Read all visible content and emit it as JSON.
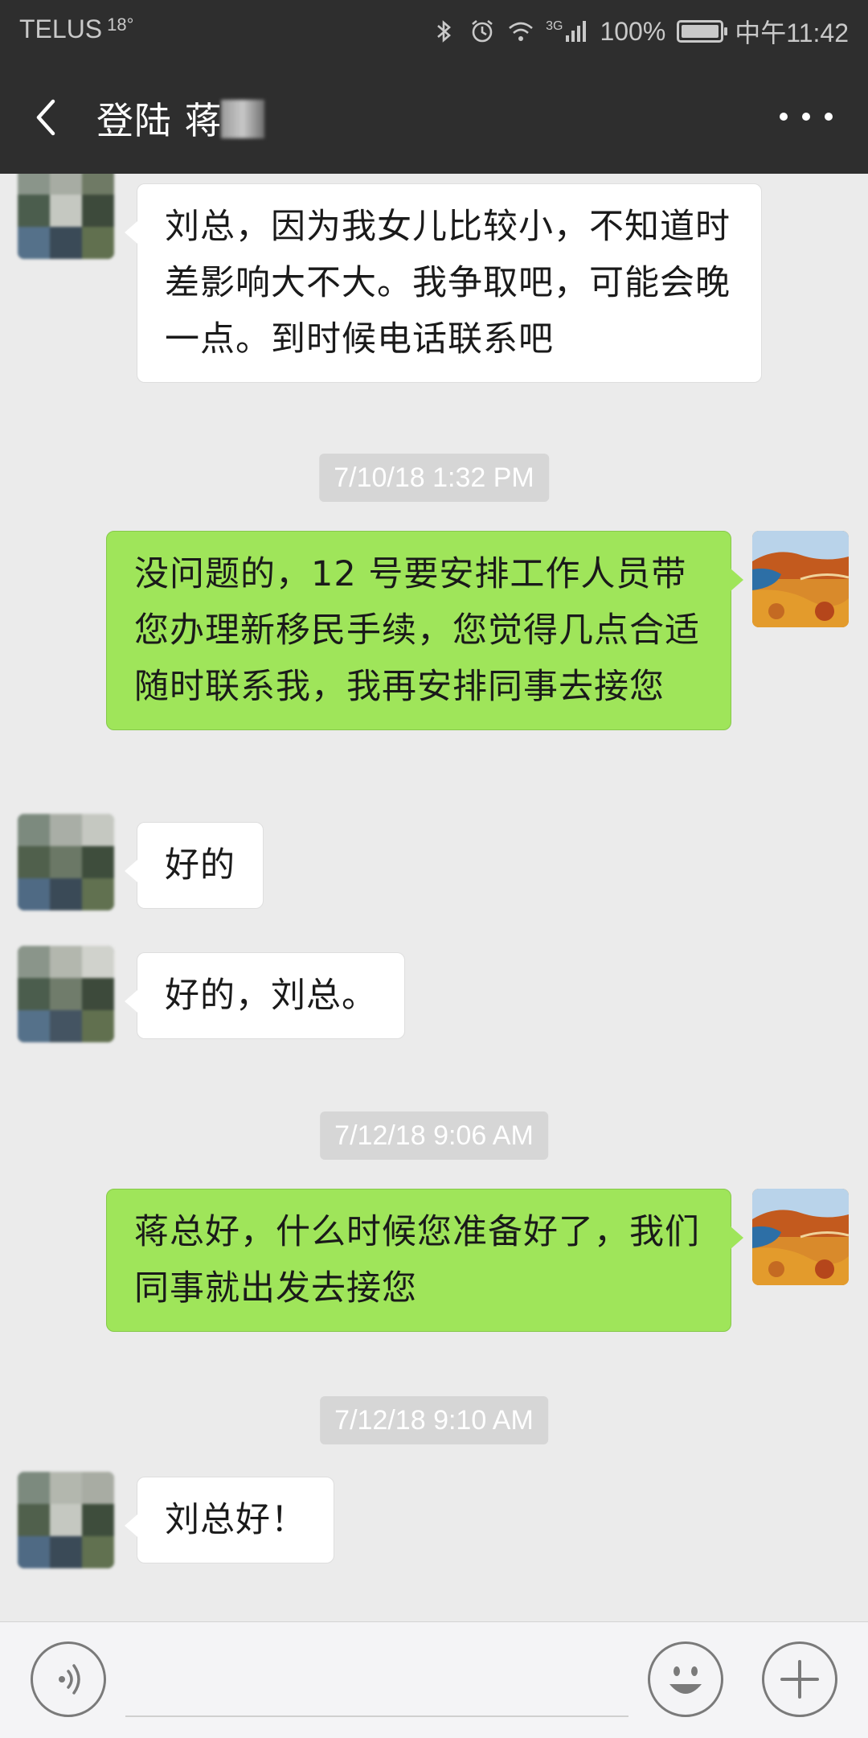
{
  "status_bar": {
    "carrier": "TELUS",
    "temperature": "18°",
    "network": "3G",
    "battery": "100%",
    "time": "中午11:42"
  },
  "nav": {
    "title": "登陆 蒋",
    "back_icon": "chevron-left-icon",
    "more_icon": "more-dots-icon"
  },
  "messages": [
    {
      "side": "in",
      "text": "刘总，因为我女儿比较小，不知道时差影响大不大。我争取吧，可能会晚一点。到时候电话联系吧"
    },
    {
      "timestamp": "7/10/18 1:32 PM"
    },
    {
      "side": "out",
      "text": "没问题的，12 号要安排工作人员带您办理新移民手续，您觉得几点合适随时联系我，我再安排同事去接您"
    },
    {
      "side": "in",
      "text": "好的"
    },
    {
      "side": "in",
      "text": "好的，刘总。"
    },
    {
      "timestamp": "7/12/18 9:06 AM"
    },
    {
      "side": "out",
      "text": "蒋总好，什么时候您准备好了，我们同事就出发去接您"
    },
    {
      "timestamp": "7/12/18 9:10 AM"
    },
    {
      "side": "in",
      "text": "刘总好！"
    }
  ],
  "input_bar": {
    "voice_icon": "voice-icon",
    "emoji_icon": "emoji-icon",
    "plus_icon": "plus-icon"
  },
  "colors": {
    "header_bg": "#2e2e2e",
    "chat_bg": "#ebebeb",
    "outgoing_bubble": "#9fe55a",
    "incoming_bubble": "#ffffff",
    "timestamp_bg": "#d6d6d6"
  }
}
